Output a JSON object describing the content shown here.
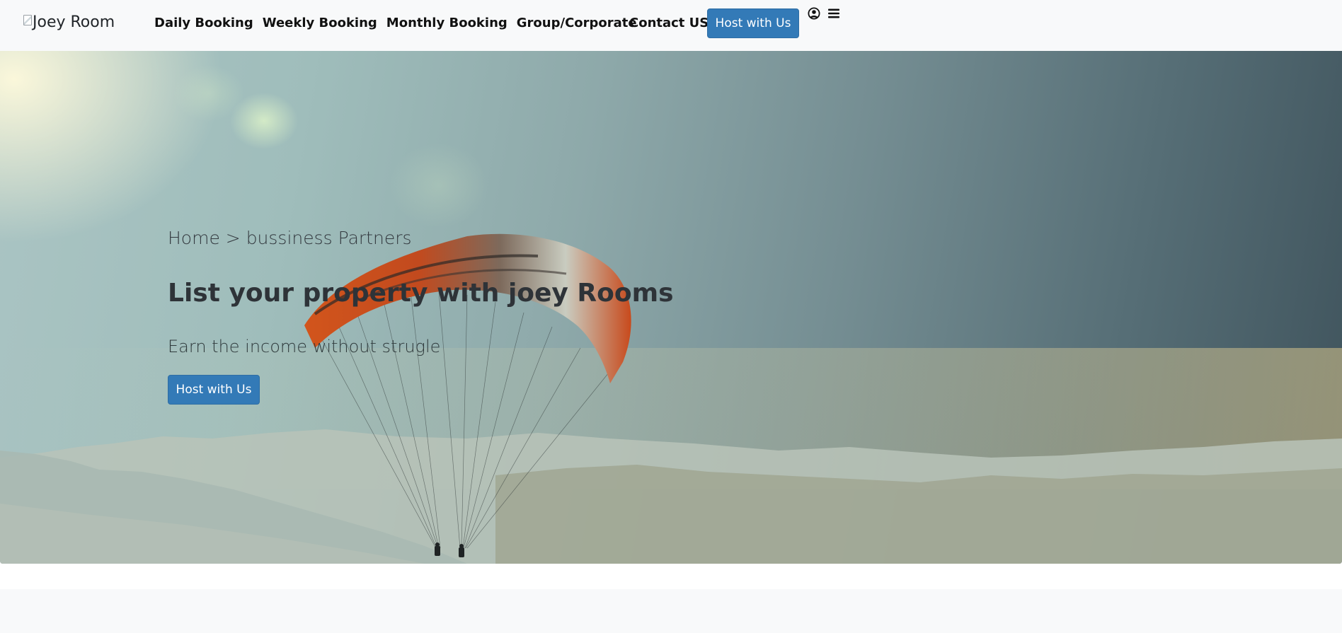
{
  "brand": {
    "logo_alt": "Joey Room",
    "icon": "broken-image-icon"
  },
  "nav": {
    "links": [
      {
        "label": "Daily Booking"
      },
      {
        "label": "Weekly Booking"
      },
      {
        "label": "Monthly Booking"
      },
      {
        "label": "Group/Corporate"
      }
    ],
    "contact_label": "Contact US",
    "host_button_label": "Host with Us",
    "user_icon": "user-circle-icon",
    "menu_icon": "hamburger-menu-icon"
  },
  "hero": {
    "breadcrumb": {
      "home": "Home",
      "separator": ">",
      "current": "bussiness Partners"
    },
    "title": "List your property with joey Rooms",
    "subtitle": "Earn the income without strugle",
    "host_button_label": "Host with Us",
    "background": "paraglider-over-mountains-photo"
  },
  "colors": {
    "primary": "#337ab7",
    "navbar_bg": "#f8f9fa",
    "text_dark": "#212529"
  }
}
